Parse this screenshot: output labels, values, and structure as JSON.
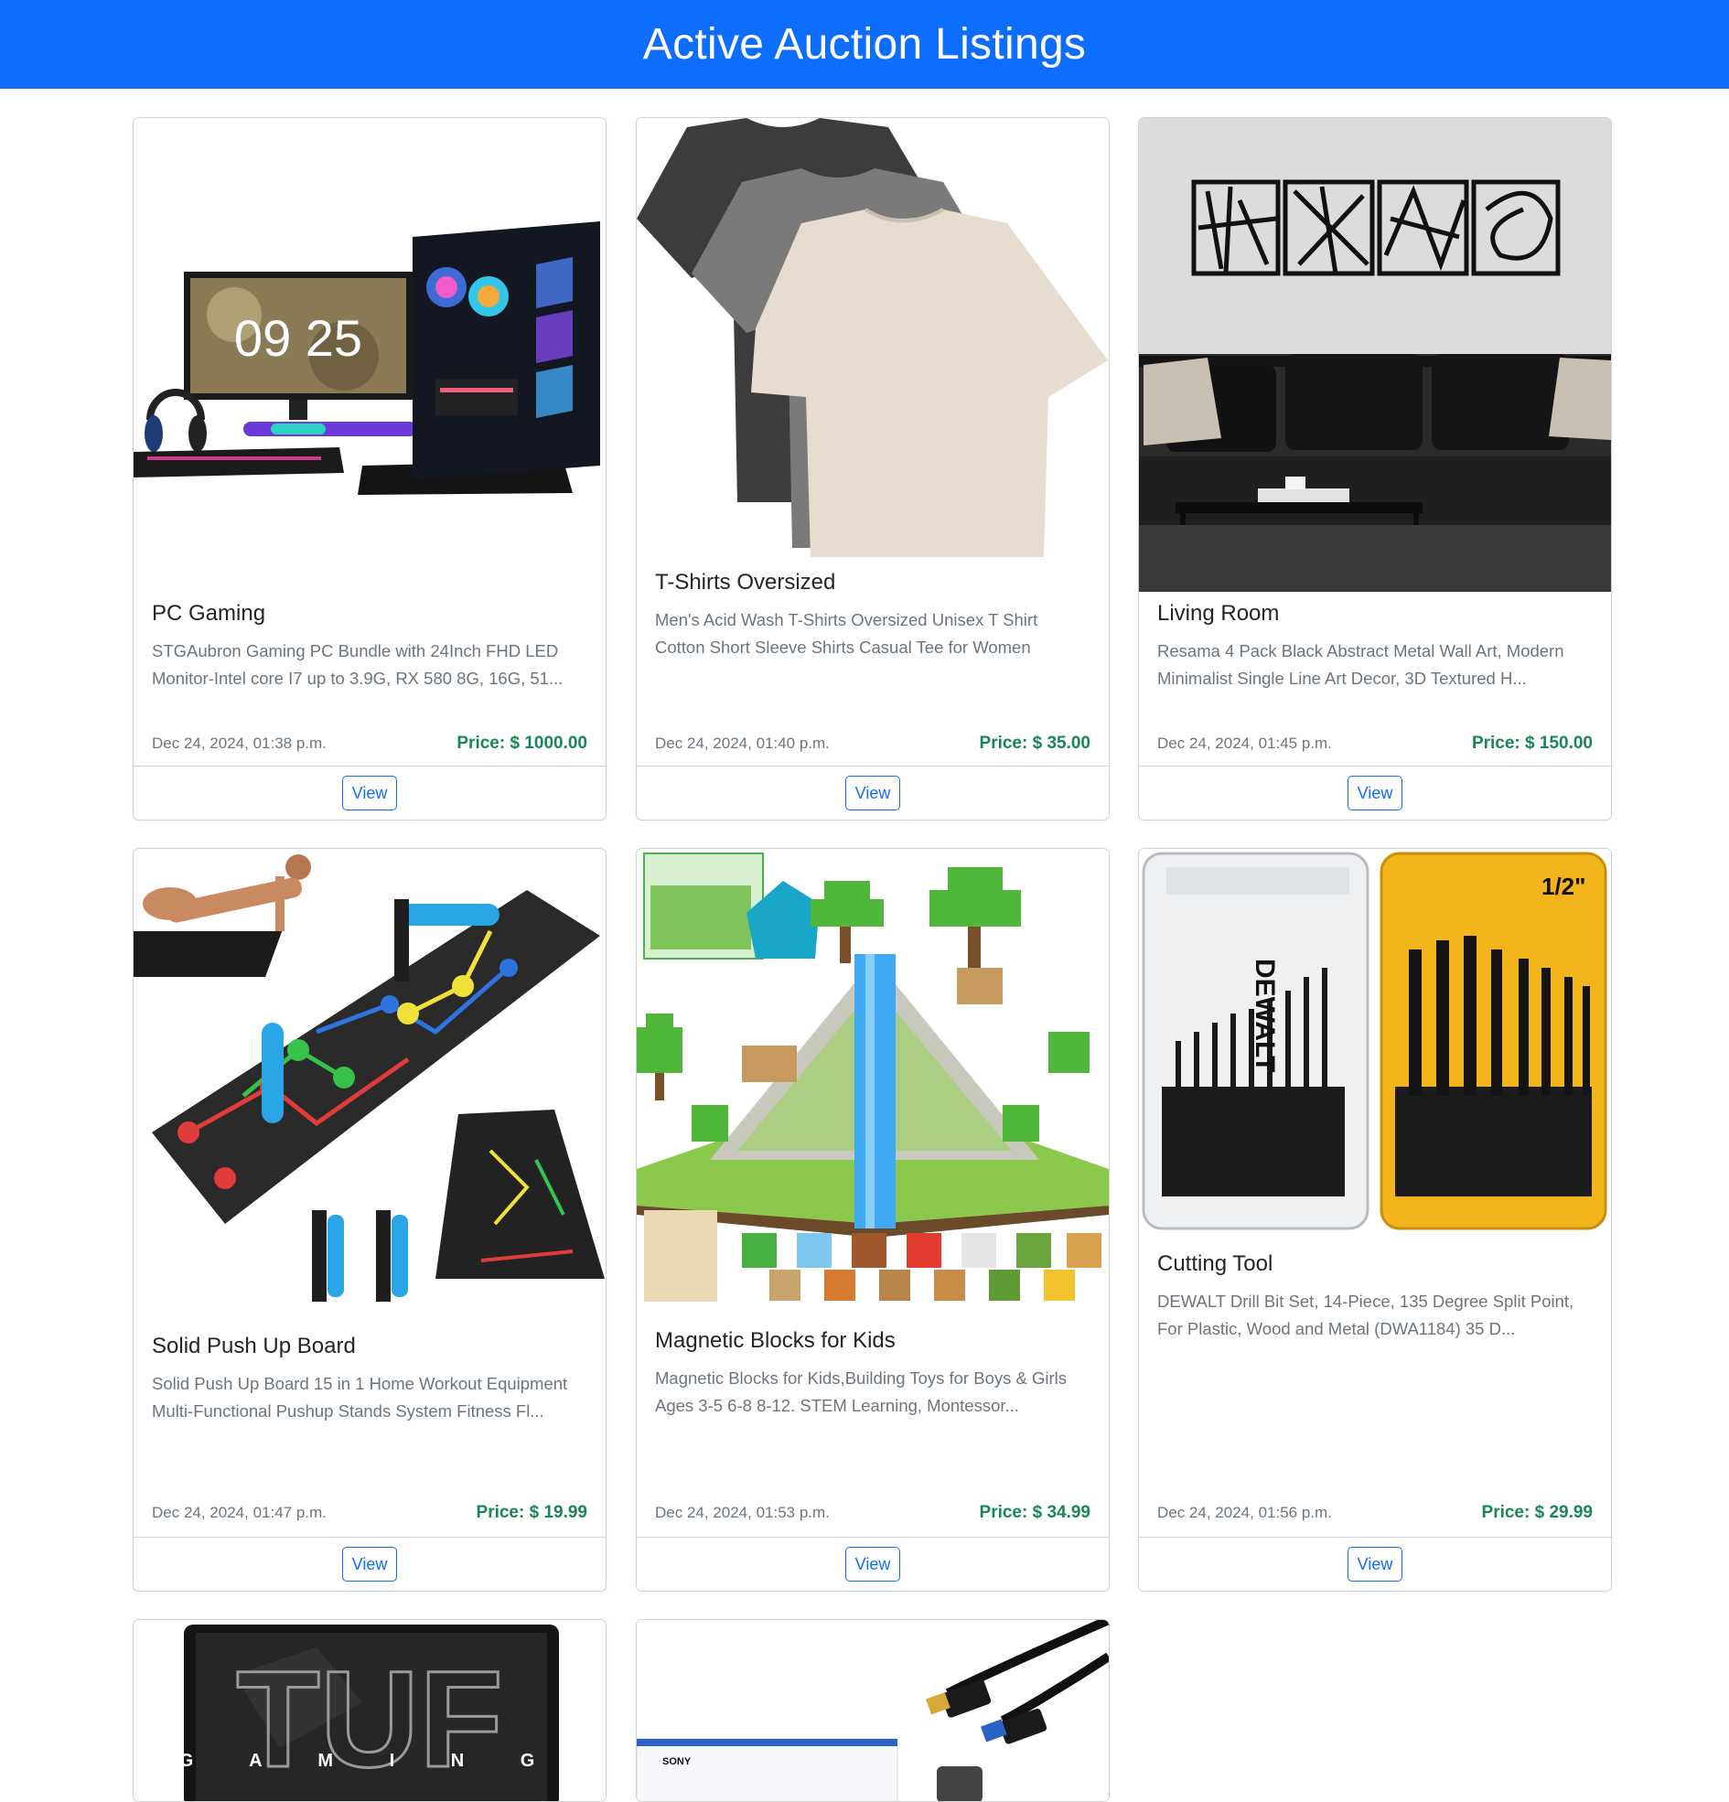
{
  "page": {
    "title": "Active Auction Listings"
  },
  "listings": [
    {
      "title": "PC Gaming",
      "description": "STGAubron Gaming PC Bundle with 24Inch FHD LED Monitor-Intel core I7 up to 3.9G, RX 580 8G, 16G, 51...",
      "date": "Dec 24, 2024, 01:38 p.m.",
      "price": "Price: $ 1000.00",
      "button": "View",
      "image_text": "09 25"
    },
    {
      "title": "T-Shirts Oversized",
      "description": "Men's Acid Wash T-Shirts Oversized Unisex T Shirt Cotton Short Sleeve Shirts Casual Tee for Women",
      "date": "Dec 24, 2024, 01:40 p.m.",
      "price": "Price: $ 35.00",
      "button": "View"
    },
    {
      "title": "Living Room",
      "description": "Resama 4 Pack Black Abstract Metal Wall Art, Modern Minimalist Single Line Art Decor, 3D Textured H...",
      "date": "Dec 24, 2024, 01:45 p.m.",
      "price": "Price: $ 150.00",
      "button": "View"
    },
    {
      "title": "Solid Push Up Board",
      "description": "Solid Push Up Board 15 in 1 Home Workout Equipment Multi-Functional Pushup Stands System Fitness Fl...",
      "date": "Dec 24, 2024, 01:47 p.m.",
      "price": "Price: $ 19.99",
      "button": "View"
    },
    {
      "title": "Magnetic Blocks for Kids",
      "description": "Magnetic Blocks for Kids,Building Toys for Boys & Girls Ages 3-5 6-8 8-12. STEM Learning, Montessor...",
      "date": "Dec 24, 2024, 01:53 p.m.",
      "price": "Price: $ 34.99",
      "button": "View"
    },
    {
      "title": "Cutting Tool",
      "description": "DEWALT Drill Bit Set, 14-Piece, 135 Degree Split Point, For Plastic, Wood and Metal (DWA1184) 35 D...",
      "date": "Dec 24, 2024, 01:56 p.m.",
      "price": "Price: $ 29.99",
      "button": "View",
      "image_text": "DEWALT",
      "image_badge": "1/2\""
    },
    {
      "image_text": "TUF",
      "image_subtext": "G A M I N G"
    },
    {
      "image_text": "SONY"
    }
  ]
}
